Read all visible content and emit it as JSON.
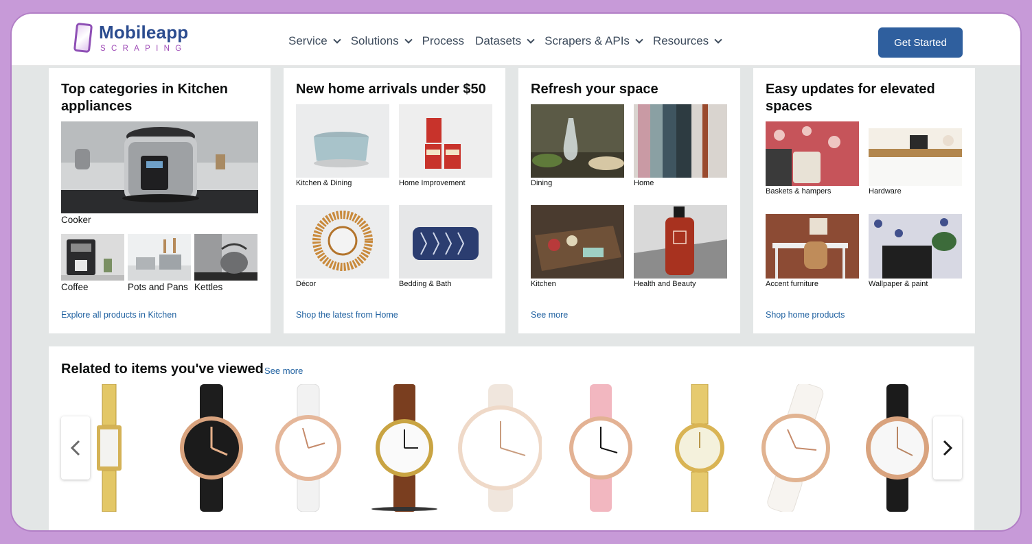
{
  "header": {
    "logo_title": "Mobileapp",
    "logo_subtitle": "SCRAPING",
    "nav": [
      {
        "label": "Service",
        "has_dropdown": true
      },
      {
        "label": "Solutions",
        "has_dropdown": true
      },
      {
        "label": "Process",
        "has_dropdown": false
      },
      {
        "label": "Datasets",
        "has_dropdown": true
      },
      {
        "label": "Scrapers & APIs",
        "has_dropdown": true
      },
      {
        "label": "Resources",
        "has_dropdown": true
      }
    ],
    "cta_label": "Get Started"
  },
  "cards": [
    {
      "title": "Top categories in Kitchen appliances",
      "tiles": [
        "Cooker",
        "Coffee",
        "Pots and Pans",
        "Kettles"
      ],
      "link": "Explore all products in Kitchen"
    },
    {
      "title": "New home arrivals under $50",
      "tiles": [
        "Kitchen & Dining",
        "Home Improvement",
        "Décor",
        "Bedding & Bath"
      ],
      "link": "Shop the latest from Home"
    },
    {
      "title": "Refresh your space",
      "tiles": [
        "Dining",
        "Home",
        "Kitchen",
        "Health and Beauty"
      ],
      "link": "See more"
    },
    {
      "title": "Easy updates for elevated spaces",
      "tiles": [
        "Baskets & hampers",
        "Hardware",
        "Accent furniture",
        "Wallpaper & paint"
      ],
      "link": "Shop home products"
    }
  ],
  "related": {
    "title": "Related to items you've viewed",
    "link": "See more"
  },
  "colors": {
    "page_bg": "#e3e6e6",
    "link": "#2162a1",
    "cta": "#2f5f9e",
    "border": "#c79ad8"
  }
}
